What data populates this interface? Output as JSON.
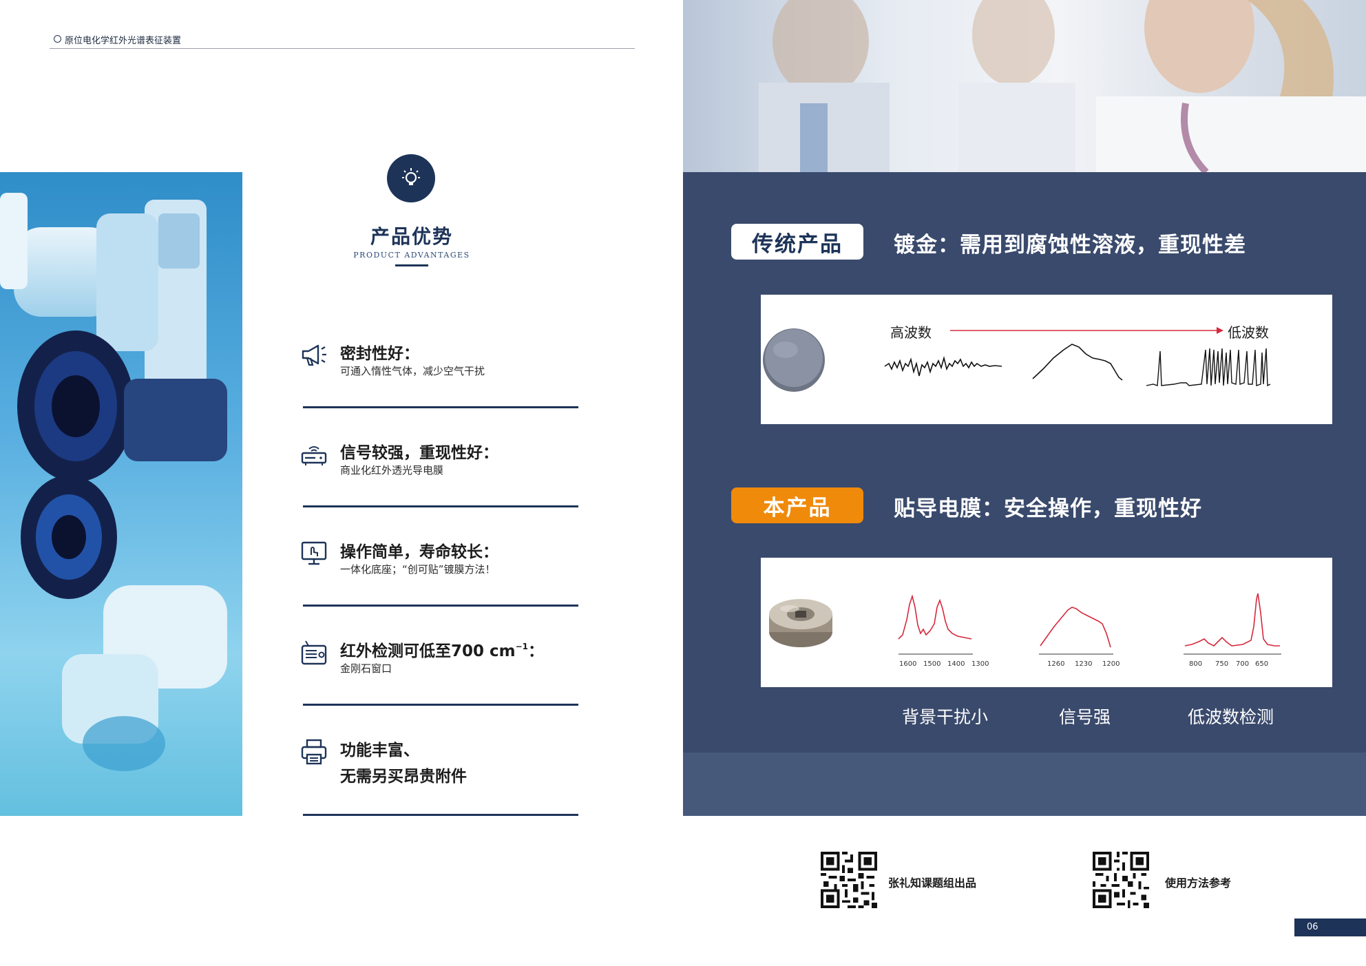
{
  "header": {
    "title": "原位电化学红外光谱表征装置"
  },
  "advantages": {
    "title": "产品优势",
    "subtitle": "PRODUCT ADVANTAGES",
    "items": [
      {
        "icon": "megaphone-icon",
        "title": "密封性好：",
        "desc": "可通入惰性气体，减少空气干扰"
      },
      {
        "icon": "router-icon",
        "title": "信号较强，重现性好：",
        "desc": "商业化红外透光导电膜"
      },
      {
        "icon": "monitor-touch-icon",
        "title": "操作简单，寿命较长：",
        "desc": "一体化底座；“创可贴”镀膜方法！"
      },
      {
        "icon": "radio-icon",
        "title_main": "红外检测可低至700 cm",
        "title_sup": "−1",
        "title_end": "：",
        "desc": "金刚石窗口"
      },
      {
        "icon": "printer-icon",
        "title": "功能丰富、",
        "title2": "无需另买昂贵附件"
      }
    ]
  },
  "traditional": {
    "label": "传统产品",
    "headline": "镀金：需用到腐蚀性溶液，重现性差",
    "high_label": "高波数",
    "low_label": "低波数"
  },
  "ours": {
    "label": "本产品",
    "headline": "贴导电膜：安全操作，重现性好",
    "axis1": [
      "1600",
      "1500",
      "1400",
      "1300"
    ],
    "axis2": [
      "1260",
      "1230",
      "1200"
    ],
    "axis3": [
      "800",
      "750",
      "700",
      "650"
    ],
    "captions": [
      "背景干扰小",
      "信号强",
      "低波数检测"
    ]
  },
  "footer": {
    "qr1_label": "张礼知课题组出品",
    "qr2_label": "使用方法参考",
    "page_number": "06"
  },
  "colors": {
    "navy": "#1d3358",
    "panel": "#3a4a6c",
    "orange": "#f08a0a",
    "spectrum_red": "#d6283c"
  }
}
